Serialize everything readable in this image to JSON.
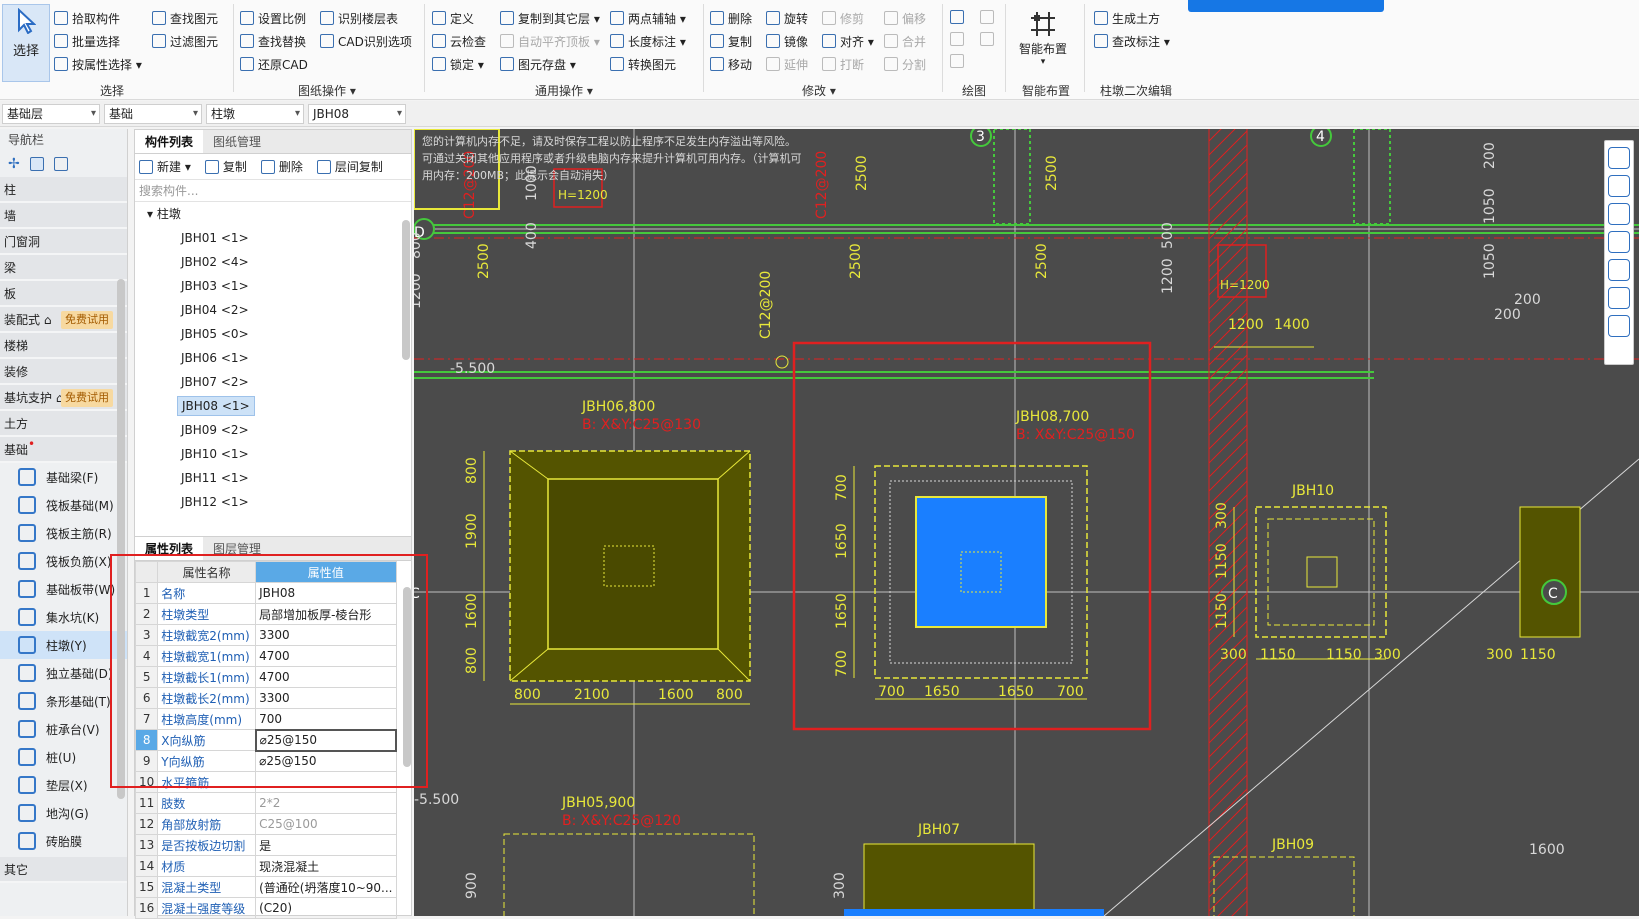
{
  "ribbon": {
    "select_big": "选择",
    "groups": [
      {
        "title": "选择"
      },
      {
        "title": "图纸操作 ▾"
      },
      {
        "title": "通用操作 ▾"
      },
      {
        "title": "修改 ▾"
      },
      {
        "title": "绘图"
      },
      {
        "title": "智能布置"
      },
      {
        "title": "柱墩二次编辑"
      }
    ],
    "select_items": [
      "拾取构件",
      "批量选择",
      "按属性选择 ▾",
      "查找图元",
      "过滤图元"
    ],
    "drawing_items": [
      "设置比例",
      "查找替换",
      "还原CAD",
      "识别楼层表",
      "CAD识别选项"
    ],
    "common_items": [
      "定义",
      "云检查",
      "锁定 ▾",
      "复制到其它层 ▾",
      "自动平齐顶板 ▾",
      "图元存盘 ▾",
      "两点辅轴 ▾",
      "长度标注 ▾",
      "转换图元"
    ],
    "modify_items": [
      "删除",
      "复制",
      "移动",
      "旋转",
      "镜像",
      "延伸",
      "修剪",
      "对齐 ▾",
      "打断",
      "偏移",
      "合并",
      "分割"
    ],
    "smart_big": "智能布置",
    "pier_items": [
      "生成土方",
      "查改标注 ▾"
    ]
  },
  "filters": [
    "基础层",
    "基础",
    "柱墩",
    "JBH08"
  ],
  "nav": {
    "title": "导航栏",
    "categories": [
      {
        "label": "柱"
      },
      {
        "label": "墙"
      },
      {
        "label": "门窗洞"
      },
      {
        "label": "梁"
      },
      {
        "label": "板"
      },
      {
        "label": "装配式 ⌂",
        "tag": "免费试用"
      },
      {
        "label": "楼梯"
      },
      {
        "label": "装修"
      },
      {
        "label": "基坑支护 ⌂",
        "tag": "免费试用"
      },
      {
        "label": "土方"
      },
      {
        "label": "基础"
      }
    ],
    "sub_items": [
      "基础梁(F)",
      "筏板基础(M)",
      "筏板主筋(R)",
      "筏板负筋(X)",
      "基础板带(W)",
      "集水坑(K)",
      "柱墩(Y)",
      "独立基础(D)",
      "条形基础(T)",
      "桩承台(V)",
      "桩(U)",
      "垫层(X)",
      "地沟(G)",
      "砖胎膜"
    ],
    "bottom": "其它"
  },
  "component_panel": {
    "tabs": [
      "构件列表",
      "图纸管理"
    ],
    "toolbar": [
      "新建 ▾",
      "复制",
      "删除",
      "层间复制"
    ],
    "search_placeholder": "搜索构件...",
    "root": "柱墩",
    "items": [
      "JBH01 <1>",
      "JBH02 <4>",
      "JBH03 <1>",
      "JBH04 <2>",
      "JBH05 <0>",
      "JBH06 <1>",
      "JBH07 <2>",
      "JBH08 <1>",
      "JBH09 <2>",
      "JBH10 <1>",
      "JBH11 <1>",
      "JBH12 <1>"
    ],
    "selected": "JBH08 <1>"
  },
  "property_panel": {
    "tabs": [
      "属性列表",
      "图层管理"
    ],
    "col_name": "属性名称",
    "col_value": "属性值",
    "rows": [
      {
        "n": "1",
        "name": "名称",
        "value": "JBH08"
      },
      {
        "n": "2",
        "name": "柱墩类型",
        "value": "局部增加板厚-棱台形"
      },
      {
        "n": "3",
        "name": "柱墩截宽2(mm)",
        "value": "3300"
      },
      {
        "n": "4",
        "name": "柱墩截宽1(mm)",
        "value": "4700"
      },
      {
        "n": "5",
        "name": "柱墩截长1(mm)",
        "value": "4700"
      },
      {
        "n": "6",
        "name": "柱墩截长2(mm)",
        "value": "3300"
      },
      {
        "n": "7",
        "name": "柱墩高度(mm)",
        "value": "700"
      },
      {
        "n": "8",
        "name": "X向纵筋",
        "value": "⌀25@150"
      },
      {
        "n": "9",
        "name": "Y向纵筋",
        "value": "⌀25@150"
      },
      {
        "n": "10",
        "name": "水平箍筋",
        "value": ""
      },
      {
        "n": "11",
        "name": "肢数",
        "value": "2*2"
      },
      {
        "n": "12",
        "name": "角部放射筋",
        "value": "C25@100"
      },
      {
        "n": "13",
        "name": "是否按板边切割",
        "value": "是"
      },
      {
        "n": "14",
        "name": "材质",
        "value": "现浇混凝土"
      },
      {
        "n": "15",
        "name": "混凝土类型",
        "value": "(普通砼(坍落度10~90..."
      },
      {
        "n": "16",
        "name": "混凝土强度等级",
        "value": "(C20)"
      }
    ]
  },
  "canvas": {
    "warning": "您的计算机内存不足，请及时保存工程以防止程序不足发生内存溢出等风险。可通过关闭其他应用程序或者升级电脑内存来提升计算机可用内存。（计算机可用内存：200MB；此提示会自动消失）",
    "labels": {
      "axis_d": "D",
      "axis_c": "C",
      "axis_c2": "C",
      "axis_3": "3",
      "axis_4": "4",
      "elev1": "-5.500",
      "elev2": "-5.500",
      "jbh06": "JBH06,800",
      "jbh06_r": "B: X&Y:C25@130",
      "jbh08": "JBH08,700",
      "jbh08_r": "B: X&Y:C25@150",
      "jbh10": "JBH10",
      "jbh05": "JBH05,900",
      "jbh05_r": "B: X&Y:C25@120",
      "jbh07": "JBH07",
      "jbh09": "JBH09",
      "hsym1": "H=1200",
      "hsym2": "H=1200",
      "d800a": "800",
      "d2100": "2100",
      "d1600a": "1600",
      "d800b": "800",
      "v800a": "800",
      "v1900": "1900",
      "v1600": "1600",
      "v800b": "800",
      "d700a": "700",
      "d1650a": "1650",
      "d1650b": "1650",
      "d700b": "700",
      "v700a": "700",
      "v1650a": "1650",
      "v1650b": "1650",
      "v700b": "700",
      "d300a": "300",
      "d1150a": "1150",
      "d1150b": "1150",
      "d300b": "300",
      "v300": "300",
      "v1150a": "1150",
      "v1150b": "1150",
      "d300c": "300",
      "d1150c": "1150",
      "d1200": "1200",
      "d1400": "1400",
      "c2500a": "2500",
      "c2500b": "2500",
      "c2500c": "2500",
      "c2500d": "2500",
      "c2500e": "2500",
      "c1000": "1000",
      "c400": "400",
      "c800": "800",
      "c1200": "1200",
      "c500": "500",
      "c1200b": "1200",
      "c200a": "200",
      "c1050a": "1050",
      "c1050b": "1050",
      "c200b": "200",
      "c200c": "200",
      "c1600": "1600",
      "c300": "300",
      "c900": "900",
      "rebar1": "C12@200",
      "rebar2": "C12@200",
      "rebar3": "C12@200"
    }
  },
  "colors": {
    "accent": "#1677e5",
    "canvas_bg": "#4b4b4b",
    "yellow": "#e8e83a",
    "green": "#45c83c",
    "red": "#e02020",
    "blue": "#1a7fff"
  }
}
